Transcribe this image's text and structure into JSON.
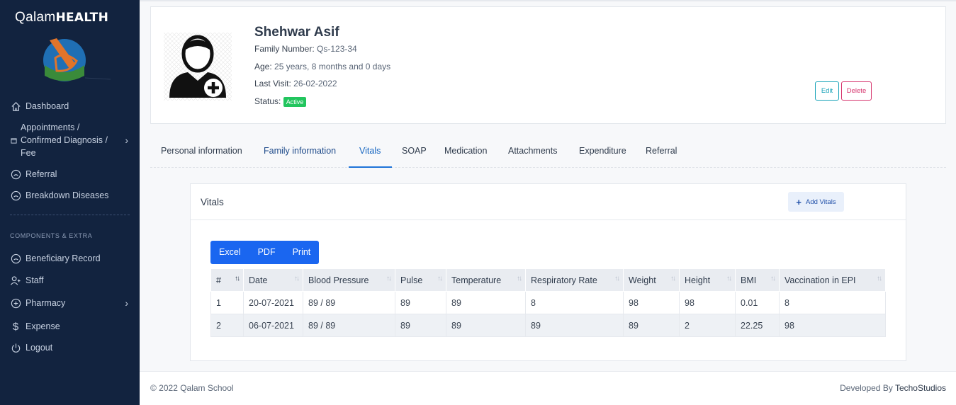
{
  "brand": {
    "prefix": "Qalam",
    "suffix": "HEALTH"
  },
  "sidebar": {
    "items": [
      {
        "label": "Dashboard",
        "icon": "home-icon"
      },
      {
        "label": "Appointments / Confirmed Diagnosis / Fee",
        "icon": "calendar-icon"
      },
      {
        "label": "Referral",
        "icon": "circle-icon"
      },
      {
        "label": "Breakdown Diseases",
        "icon": "circle-icon"
      }
    ],
    "section_label": "COMPONENTS & EXTRA",
    "items2": [
      {
        "label": "Beneficiary Record",
        "icon": "circle-icon"
      },
      {
        "label": "Staff",
        "icon": "user-plus-icon"
      },
      {
        "label": "Pharmacy",
        "icon": "plus-circle-icon"
      },
      {
        "label": "Expense",
        "icon": "dollar-icon"
      },
      {
        "label": "Logout",
        "icon": "power-icon"
      }
    ]
  },
  "profile": {
    "name": "Shehwar Asif",
    "family_number_label": "Family Number:",
    "family_number": "Qs-123-34",
    "age_label": "Age:",
    "age": "25 years, 8 months and 0 days",
    "last_visit_label": "Last Visit:",
    "last_visit": "26-02-2022",
    "status_label": "Status:",
    "status": "Active",
    "edit_label": "Edit",
    "delete_label": "Delete"
  },
  "tabs": [
    "Personal information",
    "Family information",
    "Vitals",
    "SOAP",
    "Medication",
    "Attachments",
    "Expenditure",
    "Referral"
  ],
  "active_tab": "Vitals",
  "vitals": {
    "title": "Vitals",
    "add_label": "Add Vitals",
    "export_buttons": [
      "Excel",
      "PDF",
      "Print"
    ],
    "columns": [
      "#",
      "Date",
      "Blood Pressure",
      "Pulse",
      "Temperature",
      "Respiratory Rate",
      "Weight",
      "Height",
      "BMI",
      "Vaccination in EPI"
    ],
    "rows": [
      [
        "1",
        "20-07-2021",
        "89 / 89",
        "89",
        "89",
        "8",
        "98",
        "98",
        "0.01",
        "8"
      ],
      [
        "2",
        "06-07-2021",
        "89 / 89",
        "89",
        "89",
        "89",
        "89",
        "2",
        "22.25",
        "98"
      ]
    ]
  },
  "footer": {
    "copyright": "© 2022 Qalam School",
    "developed_by": "Developed By",
    "developer": "TechoStudios"
  },
  "colors": {
    "sidebar": "#12233f",
    "primary": "#1a66f0",
    "active_badge": "#22c55e",
    "edit": "#17a2b8",
    "delete": "#d6336c"
  }
}
